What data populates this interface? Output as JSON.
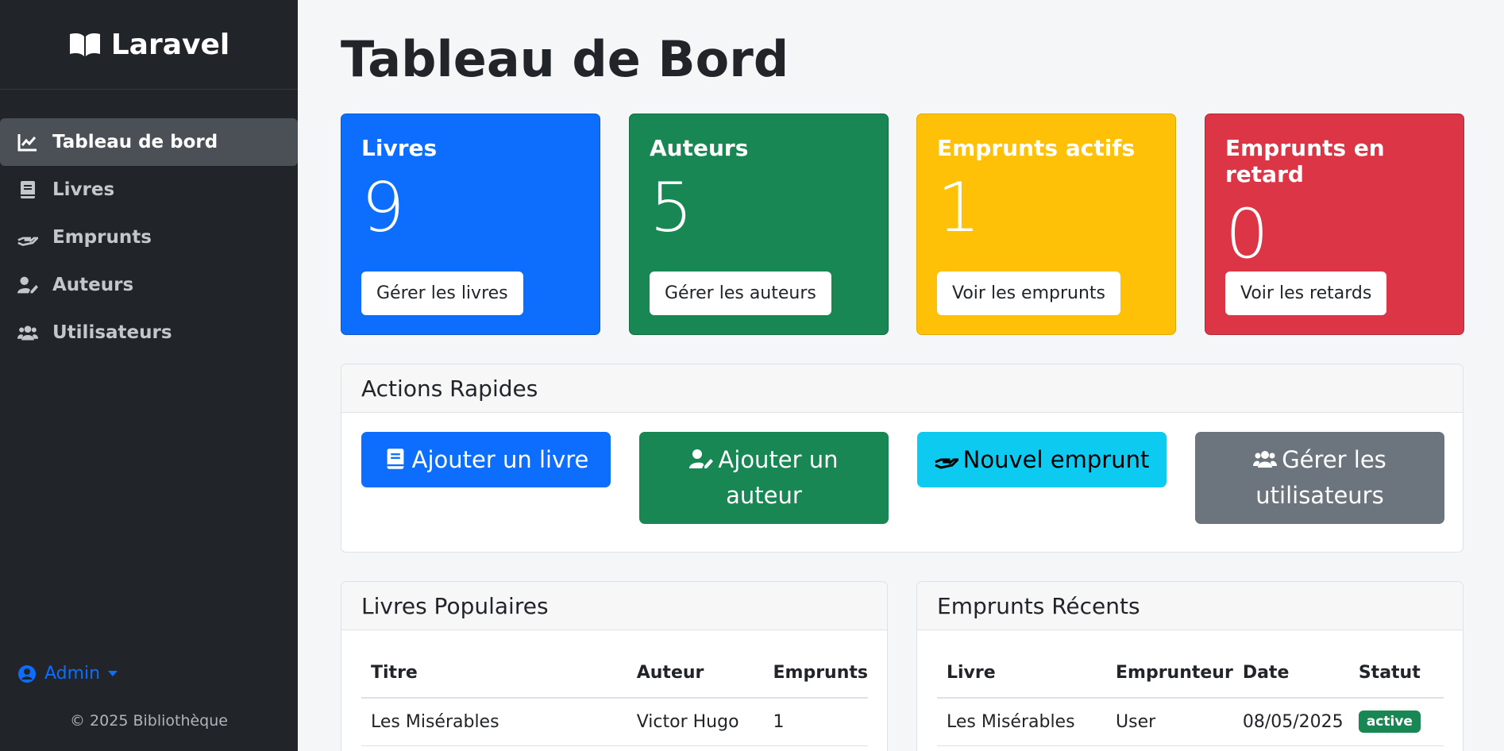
{
  "sidebar": {
    "brand": "Laravel",
    "items": [
      {
        "label": "Tableau de bord",
        "icon": "chart-line-icon",
        "active": true
      },
      {
        "label": "Livres",
        "icon": "book-icon"
      },
      {
        "label": "Emprunts",
        "icon": "hand-holding-icon"
      },
      {
        "label": "Auteurs",
        "icon": "user-edit-icon"
      },
      {
        "label": "Utilisateurs",
        "icon": "users-icon"
      }
    ],
    "user": "Admin",
    "copyright": "© 2025 Bibliothèque"
  },
  "main": {
    "title": "Tableau de Bord",
    "stats": [
      {
        "label": "Livres",
        "value": "9",
        "button": "Gérer les livres",
        "color": "#0d6efd"
      },
      {
        "label": "Auteurs",
        "value": "5",
        "button": "Gérer les auteurs",
        "color": "#198754"
      },
      {
        "label": "Emprunts actifs",
        "value": "1",
        "button": "Voir les emprunts",
        "color": "#ffc107"
      },
      {
        "label": "Emprunts en retard",
        "value": "0",
        "button": "Voir les retards",
        "color": "#dc3545"
      }
    ],
    "quick_actions": {
      "title": "Actions Rapides",
      "buttons": [
        {
          "label": "Ajouter un livre",
          "icon": "book-icon",
          "color": "#0d6efd"
        },
        {
          "label": "Ajouter un auteur",
          "icon": "user-edit-icon",
          "color": "#198754"
        },
        {
          "label": "Nouvel emprunt",
          "icon": "hand-holding-icon",
          "color": "#0dcaf0"
        },
        {
          "label": "Gérer les utilisateurs",
          "icon": "users-icon",
          "color": "#6c757d"
        }
      ]
    },
    "popular_books": {
      "title": "Livres Populaires",
      "columns": [
        "Titre",
        "Auteur",
        "Emprunts"
      ],
      "rows": [
        [
          "Les Misérables",
          "Victor Hugo",
          "1"
        ]
      ]
    },
    "recent_loans": {
      "title": "Emprunts Récents",
      "columns": [
        "Livre",
        "Emprunteur",
        "Date",
        "Statut"
      ],
      "rows": [
        [
          "Les Misérables",
          "User",
          "08/05/2025",
          "active"
        ]
      ]
    }
  }
}
